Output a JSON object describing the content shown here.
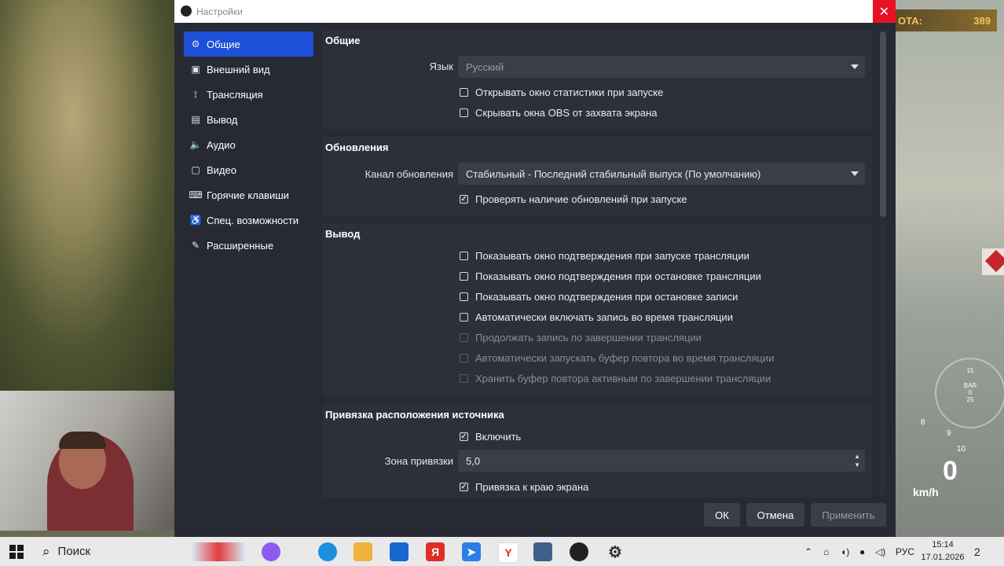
{
  "background": {
    "hud_label": "ОТА:",
    "hud_value": "389",
    "speed": "0",
    "speed_unit": "km/h",
    "speed_ticks": [
      "8",
      "9",
      "10"
    ],
    "gauge_ticks": [
      "15",
      "BAR",
      "0",
      "25"
    ]
  },
  "window": {
    "title": "Настройки",
    "close_glyph": "✕"
  },
  "sidebar": {
    "items": [
      {
        "label": "Общие",
        "icon": "gear-icon",
        "glyph": "⚙"
      },
      {
        "label": "Внешний вид",
        "icon": "appearance-icon",
        "glyph": "▣"
      },
      {
        "label": "Трансляция",
        "icon": "antenna-icon",
        "glyph": "⟟"
      },
      {
        "label": "Вывод",
        "icon": "output-icon",
        "glyph": "▤"
      },
      {
        "label": "Аудио",
        "icon": "speaker-icon",
        "glyph": "🔈"
      },
      {
        "label": "Видео",
        "icon": "monitor-icon",
        "glyph": "▢"
      },
      {
        "label": "Горячие клавиши",
        "icon": "keyboard-icon",
        "glyph": "⌨"
      },
      {
        "label": "Спец. возможности",
        "icon": "accessibility-icon",
        "glyph": "♿"
      },
      {
        "label": "Расширенные",
        "icon": "wrench-icon",
        "glyph": "✎"
      }
    ]
  },
  "general": {
    "title": "Общие",
    "language_label": "Язык",
    "language_value": "Русский",
    "open_stats_label": "Открывать окно статистики при запуске",
    "hide_obs_label": "Скрывать окна OBS от захвата экрана"
  },
  "updates": {
    "title": "Обновления",
    "channel_label": "Канал обновления",
    "channel_value": "Стабильный - Последний стабильный выпуск (По умолчанию)",
    "check_updates_label": "Проверять наличие обновлений при запуске"
  },
  "output": {
    "title": "Вывод",
    "options": [
      {
        "label": "Показывать окно подтверждения при запуске трансляции",
        "checked": false,
        "disabled": false
      },
      {
        "label": "Показывать окно подтверждения при остановке трансляции",
        "checked": false,
        "disabled": false
      },
      {
        "label": "Показывать окно подтверждения при остановке записи",
        "checked": false,
        "disabled": false
      },
      {
        "label": "Автоматически включать запись во время трансляции",
        "checked": false,
        "disabled": false
      },
      {
        "label": "Продолжать запись по завершении трансляции",
        "checked": false,
        "disabled": true
      },
      {
        "label": "Автоматически запускать буфер повтора во время трансляции",
        "checked": false,
        "disabled": true
      },
      {
        "label": "Хранить буфер повтора активным по завершении трансляции",
        "checked": false,
        "disabled": true
      }
    ]
  },
  "snapping": {
    "title": "Привязка расположения источника",
    "enable_label": "Включить",
    "zone_label": "Зона привязки",
    "zone_value": "5,0",
    "edge_label": "Привязка к краю экрана"
  },
  "buttons": {
    "ok": "ОК",
    "cancel": "Отмена",
    "apply": "Применить"
  },
  "taskbar": {
    "search_label": "Поиск",
    "language": "РУС",
    "time": "15:14",
    "date": "17.01.2026",
    "notification_count": "2"
  },
  "colors": {
    "accent": "#1d4fd8",
    "close": "#e81123",
    "dialog_bg": "#272a33"
  }
}
